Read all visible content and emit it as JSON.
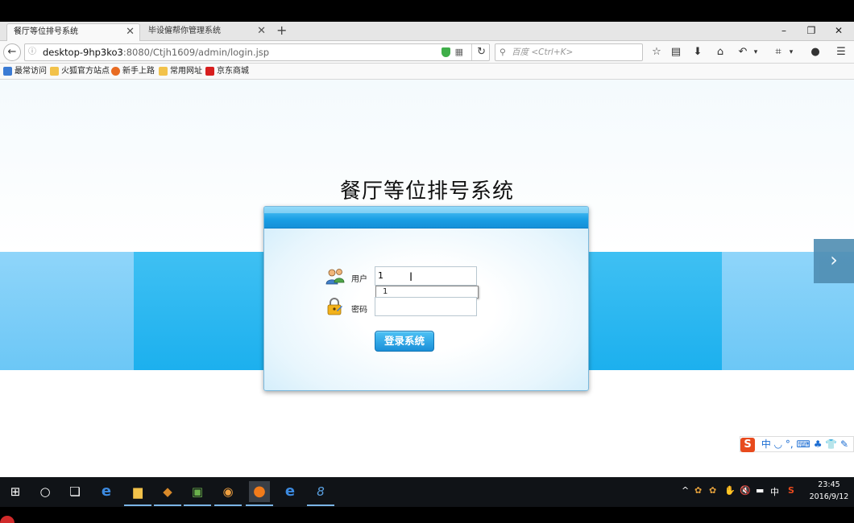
{
  "browser": {
    "tabs": [
      {
        "title": "餐厅等位排号系统",
        "active": true
      },
      {
        "title": "毕设僱帮你管理系统",
        "active": false
      }
    ],
    "new_tab_glyph": "+",
    "close_glyph": "✕",
    "window_controls": {
      "minimize": "–",
      "restore": "❐",
      "close": "✕"
    },
    "url_host": "desktop-9hp3ko3",
    "url_rest": ":8080/Ctjh1609/admin/login.jsp",
    "search_placeholder": "百度 <Ctrl+K>",
    "bookmarks": [
      {
        "label": "最常访问",
        "icon_color": "#3b7bd4"
      },
      {
        "label": "火狐官方站点",
        "icon_color": "#f2c24a"
      },
      {
        "label": "新手上路",
        "icon_color": "#e86b22"
      },
      {
        "label": "常用网址",
        "icon_color": "#f2c24a"
      },
      {
        "label": "京东商城",
        "icon_color": "#d71e1e"
      }
    ]
  },
  "page": {
    "title": "餐厅等位排号系统",
    "login": {
      "username_label": "用户",
      "username_value": "1",
      "password_label": "密码",
      "password_value": "",
      "autocomplete_item": "1",
      "submit_label": "登录系统"
    },
    "slider_next_glyph": "›"
  },
  "ime": {
    "logo": "S",
    "glyphs": "中 ◡ °, ⌨ ♣ 👕 ✎"
  },
  "taskbar": {
    "tray_items": [
      "^",
      "中"
    ],
    "time": "23:45",
    "date": "2016/9/12"
  },
  "colors": {
    "accent_blue": "#1a9fe5",
    "band_blue": "#1cb0ee",
    "taskbar": "#101317"
  }
}
